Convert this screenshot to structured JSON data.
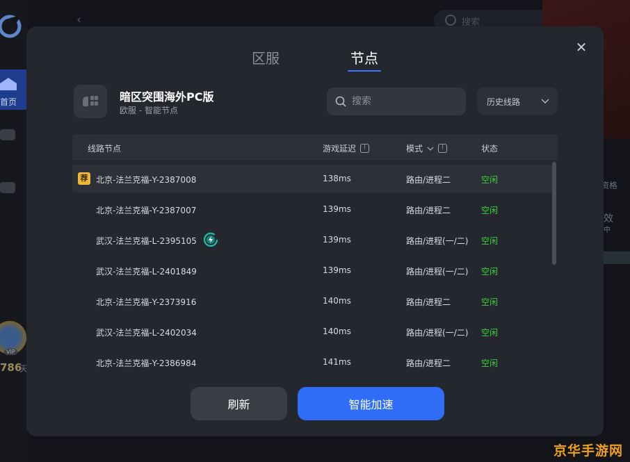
{
  "background": {
    "home_label": "首页",
    "search_placeholder": "搜索",
    "right_text_1": "资格",
    "right_text_2": "效",
    "right_text_3": "中",
    "vip_label": "VIP",
    "days_value": "786",
    "days_unit": "天"
  },
  "modal": {
    "tabs": [
      {
        "label": "区服",
        "active": false
      },
      {
        "label": "节点",
        "active": true
      }
    ],
    "game": {
      "title": "暗区突围海外PC版",
      "subtitle": "欧服 - 智能节点"
    },
    "search": {
      "placeholder": "搜索",
      "value": ""
    },
    "history": {
      "label": "历史线路"
    },
    "table": {
      "headers": {
        "node": "线路节点",
        "latency": "游戏延迟",
        "mode": "模式",
        "status": "状态"
      },
      "info_glyph": "!",
      "rows": [
        {
          "badge": "荐",
          "node": "北京-法兰克福-Y-2387008",
          "latency": "138ms",
          "mode": "路由/进程二",
          "status": "空闲"
        },
        {
          "node": "北京-法兰克福-Y-2387007",
          "latency": "139ms",
          "mode": "路由/进程二",
          "status": "空闲"
        },
        {
          "node": "武汉-法兰克福-L-2395105",
          "latency": "139ms",
          "mode": "路由/进程(一/二)",
          "status": "空闲",
          "icon": "speed-boost-icon"
        },
        {
          "node": "武汉-法兰克福-L-2401849",
          "latency": "139ms",
          "mode": "路由/进程(一/二)",
          "status": "空闲"
        },
        {
          "node": "北京-法兰克福-Y-2373916",
          "latency": "140ms",
          "mode": "路由/进程二",
          "status": "空闲"
        },
        {
          "node": "武汉-法兰克福-L-2402034",
          "latency": "140ms",
          "mode": "路由/进程(一/二)",
          "status": "空闲"
        },
        {
          "node": "北京-法兰克福-Y-2386984",
          "latency": "141ms",
          "mode": "路由/进程二",
          "status": "空闲"
        }
      ]
    },
    "buttons": {
      "refresh": "刷新",
      "accelerate": "智能加速"
    },
    "colors": {
      "accent": "#2f6df6",
      "status_idle": "#3ad13a",
      "badge": "#f2b63a"
    }
  },
  "watermark": "京华手游网"
}
